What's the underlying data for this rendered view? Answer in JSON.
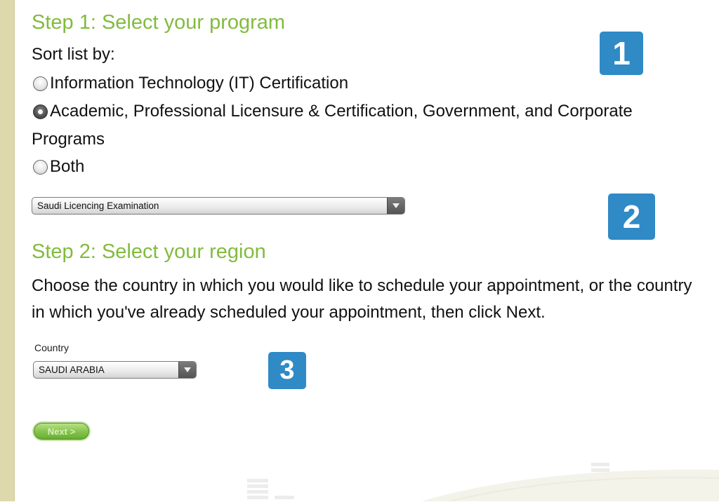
{
  "step1": {
    "title": "Step 1: Select your program",
    "sort_label": "Sort list by:",
    "options": [
      {
        "label": "Information Technology (IT) Certification",
        "checked": false
      },
      {
        "label": "Academic, Professional Licensure & Certification, Government, and Corporate Programs",
        "checked": true
      },
      {
        "label": "Both",
        "checked": false
      }
    ],
    "program_select": {
      "value": "Saudi Licencing Examination"
    }
  },
  "step2": {
    "title": "Step 2: Select your region",
    "instructions": "Choose the country in which you would like to schedule your appointment, or the country in which you've already scheduled your appointment, then click Next.",
    "country_label": "Country",
    "country_select": {
      "value": "SAUDI ARABIA"
    }
  },
  "next_button": {
    "label": "Next >"
  },
  "badges": [
    "1",
    "2",
    "3"
  ],
  "colors": {
    "heading_green": "#82bb3f",
    "badge_blue": "#2f8ac6",
    "left_bar": "#ddd9ad",
    "button_green": "#86c64e"
  },
  "icons": {
    "select_arrow": "chevron-down-icon",
    "radio_unchecked": "radio-empty",
    "radio_checked": "radio-filled"
  }
}
